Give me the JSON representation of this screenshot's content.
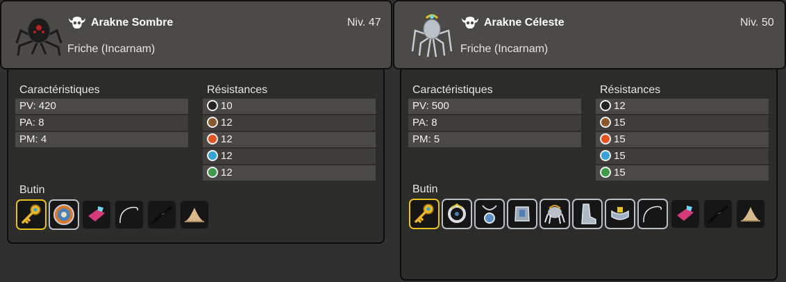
{
  "monsters": [
    {
      "name": "Arakne Sombre",
      "level": "Niv. 47",
      "zone": "Friche (Incarnam)",
      "stats_label": "Caractéristiques",
      "res_label": "Résistances",
      "loot_label": "Butin",
      "stats": [
        "PV: 420",
        "PA: 8",
        "PM: 4"
      ],
      "resistances": [
        {
          "icon": "neutral-icon",
          "value": "10"
        },
        {
          "icon": "earth-icon",
          "value": "12"
        },
        {
          "icon": "fire-icon",
          "value": "12"
        },
        {
          "icon": "water-icon",
          "value": "12"
        },
        {
          "icon": "air-icon",
          "value": "12"
        }
      ],
      "loot": [
        {
          "icon": "golden-key-icon",
          "border": "gold"
        },
        {
          "icon": "round-shield-icon",
          "border": "silver"
        },
        {
          "icon": "pink-gem-icon",
          "border": "dark"
        },
        {
          "icon": "silk-thread-icon",
          "border": "dark"
        },
        {
          "icon": "dark-leg-icon",
          "border": "dark"
        },
        {
          "icon": "sand-pile-icon",
          "border": "dark"
        }
      ]
    },
    {
      "name": "Arakne Céleste",
      "level": "Niv. 50",
      "zone": "Friche (Incarnam)",
      "stats_label": "Caractéristiques",
      "res_label": "Résistances",
      "loot_label": "Butin",
      "stats": [
        "PV: 500",
        "PA: 8",
        "PM: 5"
      ],
      "resistances": [
        {
          "icon": "neutral-icon",
          "value": "12"
        },
        {
          "icon": "earth-icon",
          "value": "15"
        },
        {
          "icon": "fire-icon",
          "value": "15"
        },
        {
          "icon": "water-icon",
          "value": "15"
        },
        {
          "icon": "air-icon",
          "value": "15"
        }
      ],
      "loot": [
        {
          "icon": "golden-key-icon",
          "border": "gold"
        },
        {
          "icon": "celestial-ring-icon",
          "border": "silver"
        },
        {
          "icon": "amulet-icon",
          "border": "silver"
        },
        {
          "icon": "armor-icon",
          "border": "silver"
        },
        {
          "icon": "spider-hat-icon",
          "border": "silver"
        },
        {
          "icon": "boots-icon",
          "border": "silver"
        },
        {
          "icon": "belt-icon",
          "border": "silver"
        },
        {
          "icon": "silk-thread-icon",
          "border": "silver"
        },
        {
          "icon": "pink-gem-icon",
          "border": "dark"
        },
        {
          "icon": "dark-leg-icon",
          "border": "dark"
        },
        {
          "icon": "sand-pile-icon",
          "border": "dark"
        }
      ]
    }
  ],
  "colors": {
    "neutral": "#222222",
    "earth": "#8b5a2b",
    "fire": "#e2541e",
    "water": "#3aa3d6",
    "air": "#3f9a4a",
    "gold_border": "#e8c21e"
  }
}
